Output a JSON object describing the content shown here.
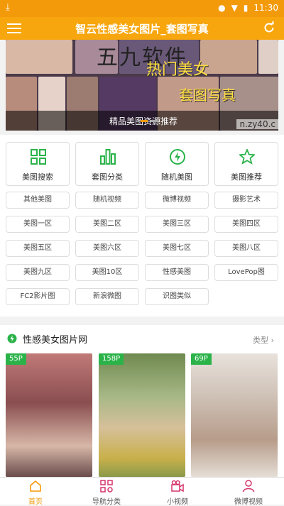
{
  "status_bar": {
    "time": "11:30"
  },
  "app_bar": {
    "title": "智云性感美女图片_套图写真"
  },
  "banner": {
    "caption": "精品美图资源推荐",
    "overlay_text_1": "五九软件",
    "overlay_text_2": "热门美女",
    "overlay_text_3": "套图写真",
    "watermark": "n.zy40.c"
  },
  "quick_actions": [
    {
      "label": "美图搜索",
      "icon": "grid-icon"
    },
    {
      "label": "套图分类",
      "icon": "bar-chart-icon"
    },
    {
      "label": "随机美图",
      "icon": "lightning-icon"
    },
    {
      "label": "美图推荐",
      "icon": "star-icon"
    }
  ],
  "category_grid": [
    "其他美图",
    "随机视频",
    "微博视频",
    "摄影艺术",
    "美图一区",
    "美图二区",
    "美图三区",
    "美图四区",
    "美图五区",
    "美图六区",
    "美图七区",
    "美图八区",
    "美图九区",
    "美图10区",
    "性感美图",
    "LovePop图",
    "FC2影片图",
    "新浪微图",
    "识图类似"
  ],
  "section": {
    "title": "性感美女图片网",
    "more_label": "类型",
    "cards": [
      {
        "badge": "55P"
      },
      {
        "badge": "158P"
      },
      {
        "badge": "69P"
      }
    ]
  },
  "tab_bar": [
    {
      "label": "首页",
      "icon": "home-icon",
      "active": true
    },
    {
      "label": "导航分类",
      "icon": "category-icon",
      "active": false
    },
    {
      "label": "小视频",
      "icon": "video-icon",
      "active": false
    },
    {
      "label": "微博视频",
      "icon": "person-icon",
      "active": false
    }
  ],
  "colors": {
    "accent": "#f7a60d",
    "green": "#2bb34a"
  }
}
